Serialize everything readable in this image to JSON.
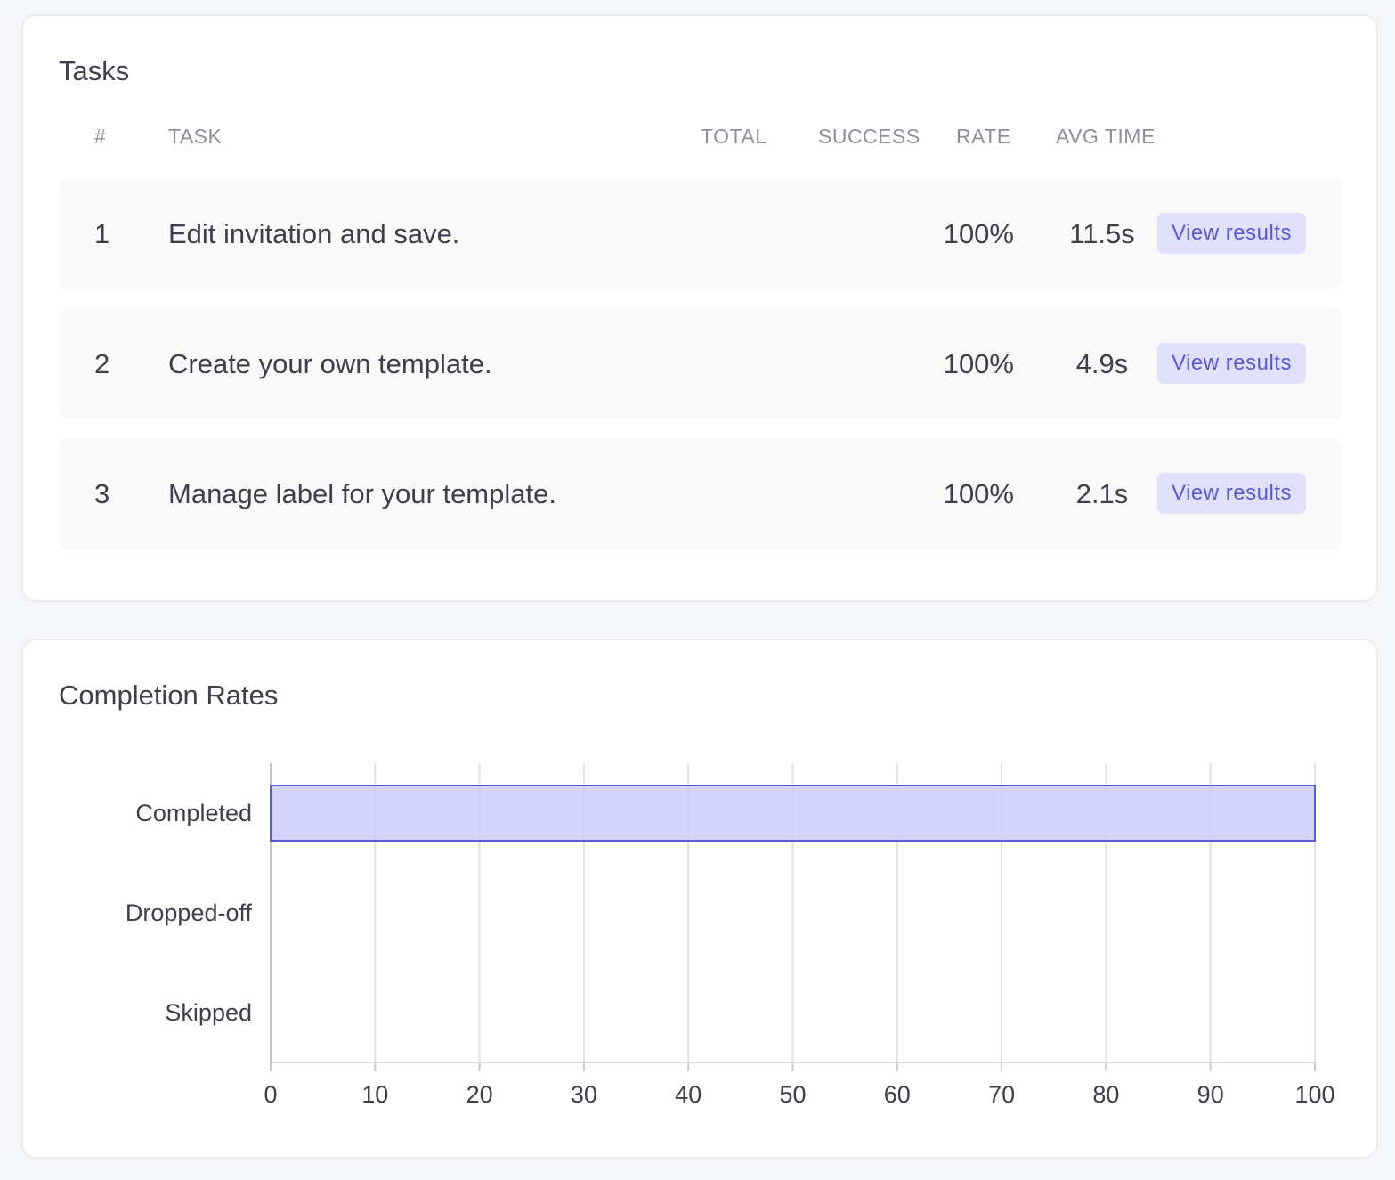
{
  "tasks": {
    "title": "Tasks",
    "columns": {
      "num": "#",
      "task": "TASK",
      "total": "TOTAL",
      "success": "SUCCESS",
      "rate": "RATE",
      "avg_time": "AVG TIME"
    },
    "rows": [
      {
        "num": "1",
        "task": "Edit invitation and save.",
        "rate": "100%",
        "avg_time": "11.5s",
        "action": "View results"
      },
      {
        "num": "2",
        "task": "Create your own template.",
        "rate": "100%",
        "avg_time": "4.9s",
        "action": "View results"
      },
      {
        "num": "3",
        "task": "Manage label for your template.",
        "rate": "100%",
        "avg_time": "2.1s",
        "action": "View results"
      }
    ]
  },
  "completion": {
    "title": "Completion Rates"
  },
  "colors": {
    "accent": "#5a59d6",
    "bar_fill": "#cbcbfa",
    "bar_stroke": "#5a59d6",
    "button_bg": "#e0e0fb"
  },
  "chart_data": {
    "type": "bar",
    "orientation": "horizontal",
    "categories": [
      "Completed",
      "Dropped-off",
      "Skipped"
    ],
    "values": [
      100,
      0,
      0
    ],
    "title": "Completion Rates",
    "xlim": [
      0,
      100
    ],
    "xticks": [
      "0",
      "10",
      "20",
      "30",
      "40",
      "50",
      "60",
      "70",
      "80",
      "90",
      "100"
    ],
    "grid": true
  }
}
